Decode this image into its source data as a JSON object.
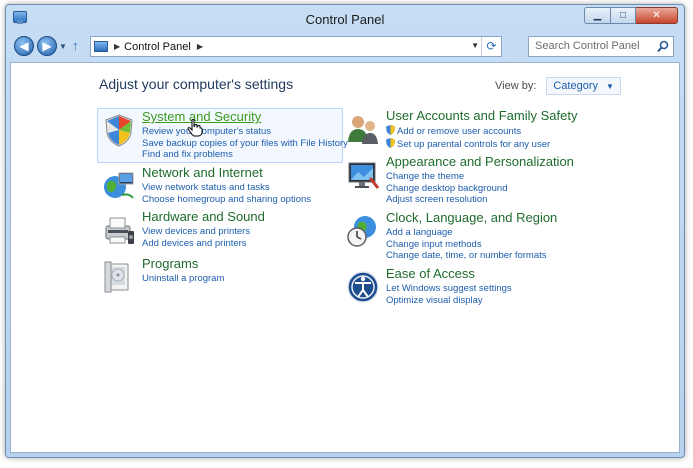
{
  "window": {
    "title": "Control Panel",
    "controls": {
      "minimize": "▁",
      "maximize": "□",
      "close": "✕"
    }
  },
  "nav": {
    "back": "◀",
    "forward": "▶",
    "address_path": "Control Panel",
    "search_placeholder": "Search Control Panel"
  },
  "main": {
    "heading": "Adjust your computer's settings",
    "view_by_label": "View by:",
    "view_by_value": "Category"
  },
  "categories": [
    {
      "title": "System and Security",
      "icon": "shield-icon",
      "links": [
        "Review your computer's status",
        "Save backup copies of your files with File History",
        "Find and fix problems"
      ]
    },
    {
      "title": "Network and Internet",
      "icon": "network-globe-icon",
      "links": [
        "View network status and tasks",
        "Choose homegroup and sharing options"
      ]
    },
    {
      "title": "Hardware and Sound",
      "icon": "printer-icon",
      "links": [
        "View devices and printers",
        "Add devices and printers"
      ]
    },
    {
      "title": "Programs",
      "icon": "programs-icon",
      "links": [
        "Uninstall a program"
      ]
    },
    {
      "title": "User Accounts and Family Safety",
      "icon": "users-icon",
      "links": [
        "Add or remove user accounts",
        "Set up parental controls for any user"
      ]
    },
    {
      "title": "Appearance and Personalization",
      "icon": "monitor-icon",
      "links": [
        "Change the theme",
        "Change desktop background",
        "Adjust screen resolution"
      ]
    },
    {
      "title": "Clock, Language, and Region",
      "icon": "clock-globe-icon",
      "links": [
        "Add a language",
        "Change input methods",
        "Change date, time, or number formats"
      ]
    },
    {
      "title": "Ease of Access",
      "icon": "ease-of-access-icon",
      "links": [
        "Let Windows suggest settings",
        "Optimize visual display"
      ]
    }
  ]
}
